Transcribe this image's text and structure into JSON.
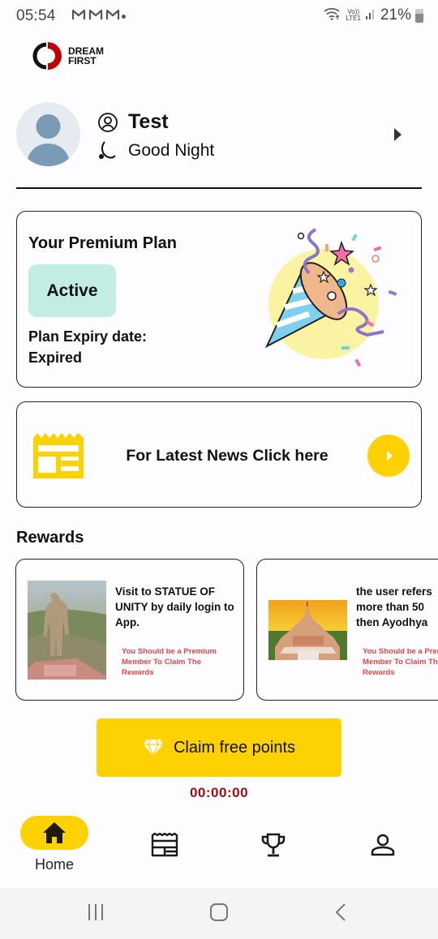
{
  "status_bar": {
    "time": "05:54",
    "notification_icons": [
      "gmail-icon",
      "gmail-icon",
      "gmail-icon"
    ],
    "volte_top": "Vo))",
    "volte_bottom": "LTE1",
    "battery": "21%"
  },
  "logo": {
    "line1": "DREAM",
    "line2": "FIRST"
  },
  "profile": {
    "name": "Test",
    "greeting": "Good Night"
  },
  "plan": {
    "title": "Your Premium Plan",
    "status": "Active",
    "expiry_label": "Plan Expiry date:",
    "expiry_value": "Expired"
  },
  "news": {
    "label": "For Latest News Click here"
  },
  "rewards": {
    "title": "Rewards",
    "items": [
      {
        "description": "Visit to STATUE OF UNITY by daily login to App.",
        "note": "You Should be a Premium Member To Claim The Rewards",
        "image": "statue-of-unity-photo"
      },
      {
        "description_lines": [
          "the user refers",
          "more than 50",
          "then Ayodhya"
        ],
        "note_lines": [
          "You Should be a Premium",
          "Member To Claim The",
          "Rewards"
        ],
        "image": "ayodhya-temple-photo"
      }
    ]
  },
  "claim": {
    "label": "Claim free points",
    "timer": "00:00:00"
  },
  "bottom_nav": {
    "items": [
      {
        "label": "Home",
        "icon": "home-icon",
        "active": true
      },
      {
        "label": "",
        "icon": "news-icon",
        "active": false
      },
      {
        "label": "",
        "icon": "trophy-icon",
        "active": false
      },
      {
        "label": "",
        "icon": "profile-icon",
        "active": false
      }
    ]
  },
  "colors": {
    "accent_yellow": "#fdd102",
    "badge_mint": "#c2ede2",
    "warning_red": "#e04848",
    "timer_red": "#9b0f0f",
    "brand_red": "#c00000"
  }
}
